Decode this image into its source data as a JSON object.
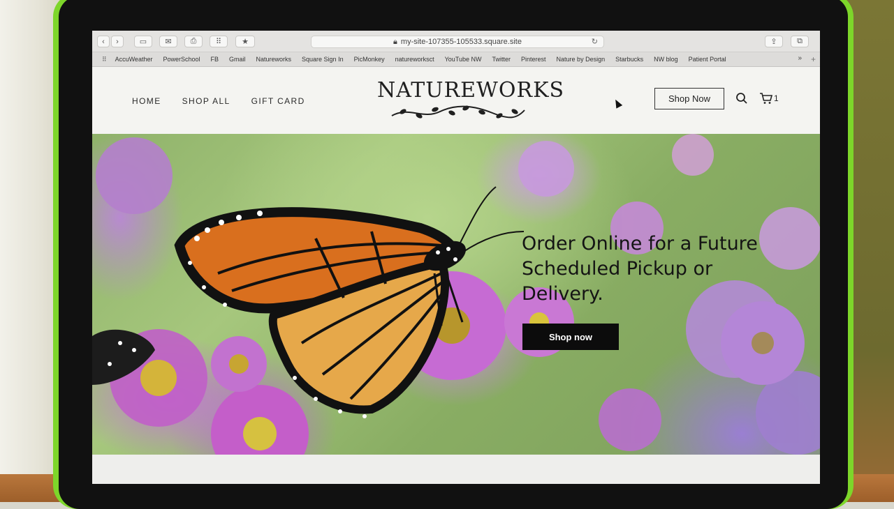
{
  "browser": {
    "url": "my-site-107355-105533.square.site",
    "bookmarks": [
      "AccuWeather",
      "PowerSchool",
      "FB",
      "Gmail",
      "Natureworks",
      "Square Sign In",
      "PicMonkey",
      "natureworksct",
      "YouTube NW",
      "Twitter",
      "Pinterest",
      "Nature by Design",
      "Starbucks",
      "NW blog",
      "Patient Portal"
    ],
    "more_label": "»",
    "icons": [
      "back-icon",
      "forward-icon",
      "sidebar-icon",
      "mail-icon",
      "print-icon",
      "grid-icon",
      "bookmark-icon",
      "lock-icon",
      "reload-icon",
      "share-icon",
      "tabs-icon"
    ]
  },
  "site": {
    "nav": [
      "HOME",
      "SHOP ALL",
      "GIFT CARD"
    ],
    "logo": "NATUREWORKS",
    "shop_now_header": "Shop Now",
    "cart_count": "1"
  },
  "hero": {
    "headline": "Order Online for a Future Scheduled Pickup or Delivery.",
    "button": "Shop now"
  },
  "colors": {
    "accent": "#0c0c0c",
    "laptop_case": "#7dd62a",
    "page_bg": "#f4f4f1"
  }
}
